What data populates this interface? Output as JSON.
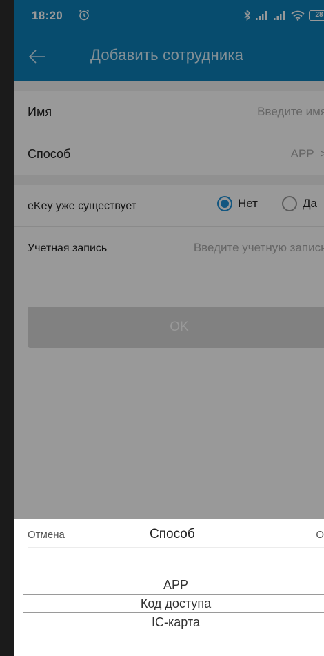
{
  "status": {
    "time": "18:20",
    "battery": "28"
  },
  "header": {
    "title": "Добавить сотрудника"
  },
  "form": {
    "name_label": "Имя",
    "name_placeholder": "Введите имя",
    "method_label": "Способ",
    "method_value": "APP",
    "method_chevron": ">",
    "ekey_label": "eKey уже существует",
    "ekey_options": [
      "Нет",
      "Да"
    ],
    "ekey_selected": "Нет",
    "account_label": "Учетная запись",
    "account_placeholder": "Введите учетную запись",
    "ok_label": "OK"
  },
  "picker": {
    "cancel_label": "Отмена",
    "title": "Способ",
    "ok_label": "OK",
    "options": [
      "APP",
      "Код доступа",
      "IC-карта"
    ],
    "selected": "APP"
  },
  "colors": {
    "header_blue": "#0d7fb8",
    "radio_blue": "#1e8fd6"
  },
  "icons": {
    "back": "arrow-left-icon",
    "alarm": "alarm-clock-icon",
    "bluetooth": "bluetooth-icon",
    "signal": "signal-icon",
    "wifi": "wifi-icon",
    "battery": "battery-icon"
  }
}
